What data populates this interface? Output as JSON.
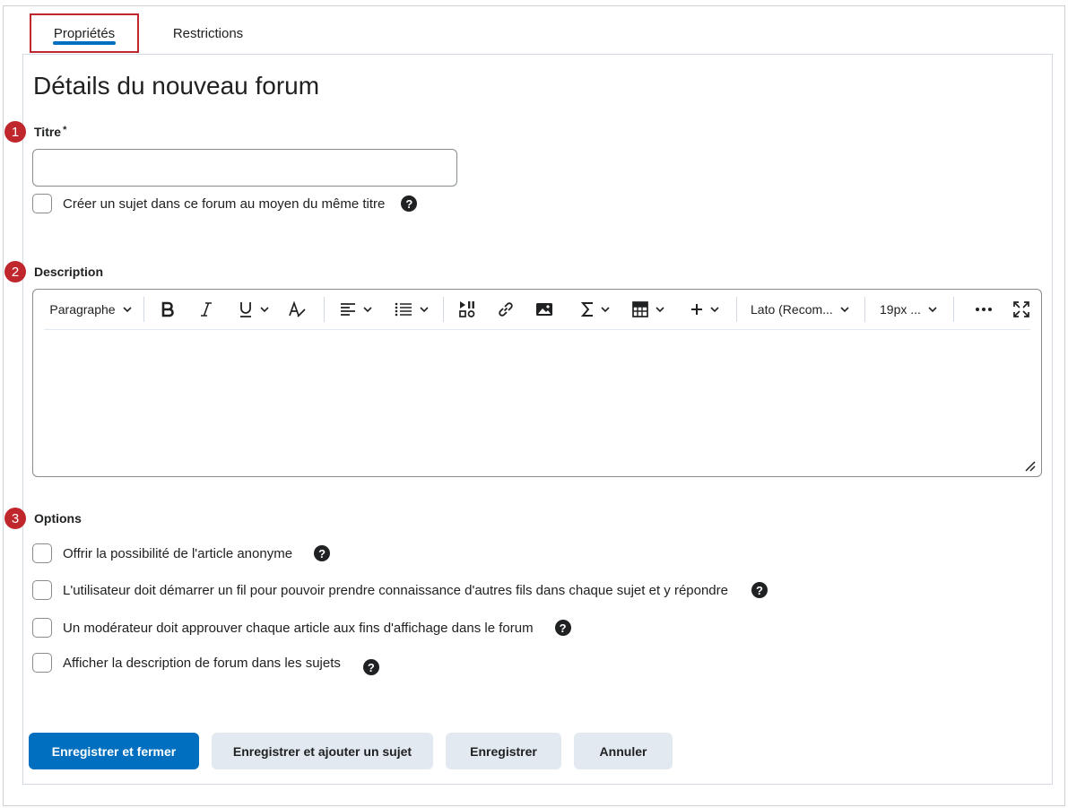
{
  "tabs": [
    {
      "label": "Propriétés",
      "active": true
    },
    {
      "label": "Restrictions",
      "active": false
    }
  ],
  "page_title": "Détails du nouveau forum",
  "steps": [
    "1",
    "2",
    "3"
  ],
  "title_field": {
    "label": "Titre",
    "required_marker": "*",
    "value": ""
  },
  "create_topic_checkbox": {
    "label": "Créer un sujet dans ce forum au moyen du même titre",
    "checked": false
  },
  "description": {
    "label": "Description",
    "toolbar": {
      "block_format": "Paragraphe",
      "font_family": "Lato (Recom...",
      "font_size": "19px ...",
      "icons": [
        "bold-icon",
        "italic-icon",
        "underline-icon",
        "format-clear-icon",
        "align-icon",
        "list-icon",
        "insert-stuff-icon",
        "link-icon",
        "image-icon",
        "equation-icon",
        "table-icon",
        "insert-plus-icon",
        "more-icon",
        "fullscreen-icon"
      ]
    },
    "content": ""
  },
  "options": {
    "label": "Options",
    "items": [
      {
        "label": "Offrir la possibilité de l'article anonyme",
        "checked": false
      },
      {
        "label": "L'utilisateur doit démarrer un fil pour pouvoir prendre connaissance d'autres fils dans chaque sujet et y répondre",
        "checked": false
      },
      {
        "label": "Un modérateur doit approuver chaque article aux fins d'affichage dans le forum",
        "checked": false
      },
      {
        "label": "Afficher la description de forum dans les sujets",
        "checked": false
      }
    ]
  },
  "help_glyph": "?",
  "buttons": {
    "save_close": "Enregistrer et fermer",
    "save_add_topic": "Enregistrer et ajouter un sujet",
    "save": "Enregistrer",
    "cancel": "Annuler"
  },
  "colors": {
    "primary": "#006fbf",
    "highlight_red": "#c0272d",
    "secondary_bg": "#e3e9f1"
  }
}
